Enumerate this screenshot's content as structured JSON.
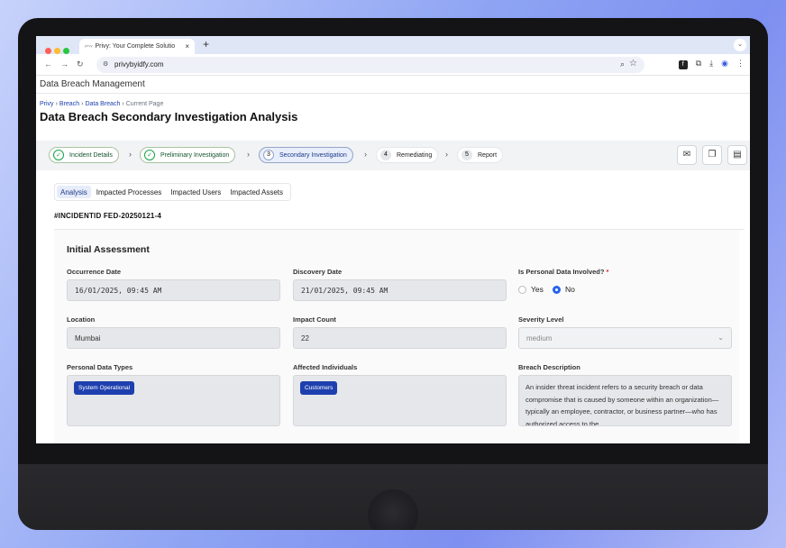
{
  "browser": {
    "tab_title": "Privy: Your Complete Solutio",
    "tab_close": "×",
    "new_tab": "+",
    "favicon": "privy",
    "url": "privybyidfy.com",
    "colors": {
      "close": "#ff5f57",
      "minimize": "#febc2e",
      "maximize": "#28c840"
    }
  },
  "app": {
    "header": "Data Breach Management",
    "breadcrumb": [
      "Privy",
      "Breach",
      "Data Breach",
      "Current Page"
    ],
    "page_title": "Data Breach Secondary Investigation Analysis"
  },
  "steps": [
    {
      "label": "Incident Details",
      "state": "done"
    },
    {
      "label": "Preliminary Investigation",
      "state": "done"
    },
    {
      "num": "3",
      "label": "Secondary Investigation",
      "state": "active"
    },
    {
      "num": "4",
      "label": "Remediating",
      "state": "todo"
    },
    {
      "num": "5",
      "label": "Report",
      "state": "todo"
    }
  ],
  "tabs": [
    "Analysis",
    "Impacted Processes",
    "Impacted Users",
    "Impacted Assets"
  ],
  "incident_id": "#INCIDENTID FED-20250121-4",
  "assessment": {
    "title": "Initial Assessment",
    "occurrence_label": "Occurrence Date",
    "occurrence_value": "16/01/2025, 09:45 AM",
    "discovery_label": "Discovery Date",
    "discovery_value": "21/01/2025, 09:45 AM",
    "personal_label": "Is Personal Data Involved?",
    "required_mark": "*",
    "yes": "Yes",
    "no": "No",
    "selected": "No",
    "location_label": "Location",
    "location_value": "Mumbai",
    "impact_label": "Impact Count",
    "impact_value": "22",
    "severity_label": "Severity Level",
    "severity_value": "medium",
    "types_label": "Personal Data Types",
    "types_chip": "System Operational",
    "affected_label": "Affected Individuals",
    "affected_chip": "Customers",
    "description_label": "Breach Description",
    "description_value": "An insider threat incident refers to a security breach or data compromise that is caused by someone within an organization—typically an employee, contractor, or business partner—who has authorized access to the"
  }
}
